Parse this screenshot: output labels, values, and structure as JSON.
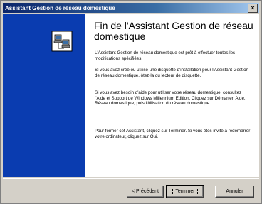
{
  "window": {
    "title": "Assistant Gestion de réseau domestique",
    "close_glyph": "×"
  },
  "content": {
    "heading": "Fin de l'Assistant Gestion de réseau domestique",
    "paragraphs": [
      "L'Assistant Gestion de réseau domestique est prêt à effectuer toutes les modifications spécifiées.",
      "Si vous avez créé ou utilisé une disquette d'installation pour l'Assistant Gestion de réseau domestique, ôtez-la du lecteur de disquette.",
      "Si vous avez besoin d'aide pour utiliser votre réseau domestique, consultez l'Aide et Support de Windows Millennium Edition. Cliquez sur Démarrer, Aide, Réseau domestique, puis Utilisation du réseau domestique.",
      "Pour fermer cet Assistant, cliquez sur Terminer. Si vous êtes invité à redémarrer votre ordinateur, cliquez sur Oui."
    ]
  },
  "buttons": {
    "back": "< Précédent",
    "finish": "Terminer",
    "cancel": "Annuler"
  },
  "colors": {
    "sidebar": "#0a3cb0",
    "titlebar_start": "#0a246a",
    "face": "#d4d0c8"
  }
}
